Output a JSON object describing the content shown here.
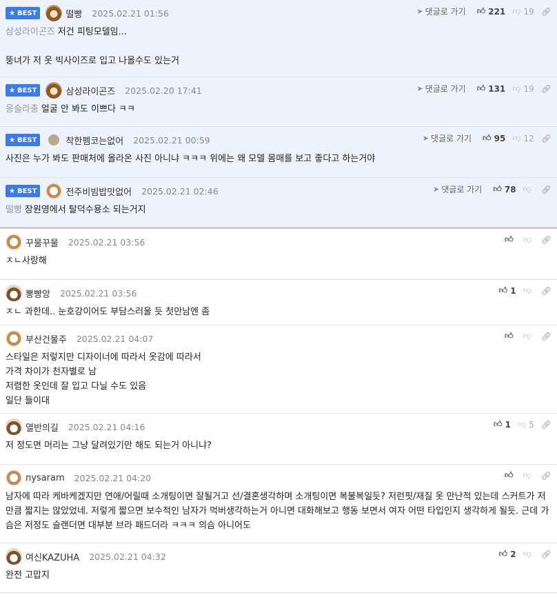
{
  "reply_label": "댓글로 가기",
  "best_label": "BEST",
  "comments": [
    {
      "best": true,
      "avatar": "bear-avatar",
      "nick": "떨빵",
      "date": "2025.02.21 01:56",
      "likes": "221",
      "dislikes": "19",
      "mention": "삼성라이곤즈",
      "text": "저건 피팅모델임...\n\n뚱녀가 저 옷 빅사이즈로 입고 나올수도 있는거"
    },
    {
      "best": true,
      "avatar": "bear-avatar",
      "nick": "삼성라이곤즈",
      "date": "2025.02.20 17:41",
      "likes": "131",
      "dislikes": "19",
      "mention": "응슬라충",
      "text": "얼굴 안 봐도 이쁘다 ㅋㅋ"
    },
    {
      "best": true,
      "avatar": "dot-avatar",
      "nick": "착한펨코는없어",
      "date": "2025.02.21 00:59",
      "likes": "95",
      "dislikes": "12",
      "mention": "",
      "text": "사진은 누가 봐도 판매처에 올라온 사진 아니냐 ㅋㅋㅋ 위에는 왜 모델 몸매를 보고 좋다고 하는거야"
    },
    {
      "best": true,
      "avatar": "dog-avatar",
      "nick": "전주비빔밥맛없어",
      "date": "2025.02.21 02:46",
      "likes": "78",
      "dislikes": "",
      "mention": "떨빵",
      "text": "장원영에서 탈덕수용소 되는거지"
    },
    {
      "best": false,
      "avatar": "dog-avatar",
      "nick": "꾸물꾸물",
      "date": "2025.02.21 03:56",
      "likes": "",
      "dislikes": "",
      "mention": "",
      "text": "ㅈㄴ사랑해"
    },
    {
      "best": false,
      "avatar": "fox-avatar",
      "nick": "뽕빵앙",
      "date": "2025.02.21 03:56",
      "likes": "1",
      "dislikes": "",
      "mention": "",
      "text": "ㅈㄴ 과한데.. 눈호강이어도 부담스러울 듯 첫만남엔 좀"
    },
    {
      "best": false,
      "avatar": "dog-avatar",
      "nick": "부산건물주",
      "date": "2025.02.21 04:07",
      "likes": "",
      "dislikes": "",
      "mention": "",
      "text": "스타일은 저렇지만 디자이너에 따라서 옷감에 따라서\n가격 차이가 천자별로 남\n저렴한 옷인데 잘 입고 다닐 수도 있음\n일단 들이대"
    },
    {
      "best": false,
      "avatar": "fox-avatar",
      "nick": "열반의길",
      "date": "2025.02.21 04:16",
      "likes": "1",
      "dislikes": "5",
      "mention": "",
      "text": "저 정도면 머리는 그냥 달려있기만 해도 되는거 아니냐?"
    },
    {
      "best": false,
      "avatar": "dog-avatar",
      "nick": "nysaram",
      "date": "2025.02.21 04:20",
      "likes": "",
      "dislikes": "",
      "mention": "",
      "text": "남자에 따라 케바케겠지만 연애/어릴때 소개팅이면 잘될거고 선/결혼생각하며 소개팅이면 복불복일듯? 저런핏/재질 옷 만난적 있는데 스커트가 저만큼 짧지는 않았었네. 저렇게 짧으면 보수적인 남자가 먹버생각하는거 아니면 대화해보고 행동 보면서 여자 어떤 타입인지 생각하게 될듯. 근데 가슴은 저정도 슬랜더면 대부분 브라 패드더라 ㅋㅋㅋ 의슴 아니어도"
    },
    {
      "best": false,
      "avatar": "fox-avatar",
      "nick": "여신KAZUHA",
      "date": "2025.02.21 04:32",
      "likes": "2",
      "dislikes": "",
      "mention": "",
      "text": "완전 고맙지"
    }
  ]
}
